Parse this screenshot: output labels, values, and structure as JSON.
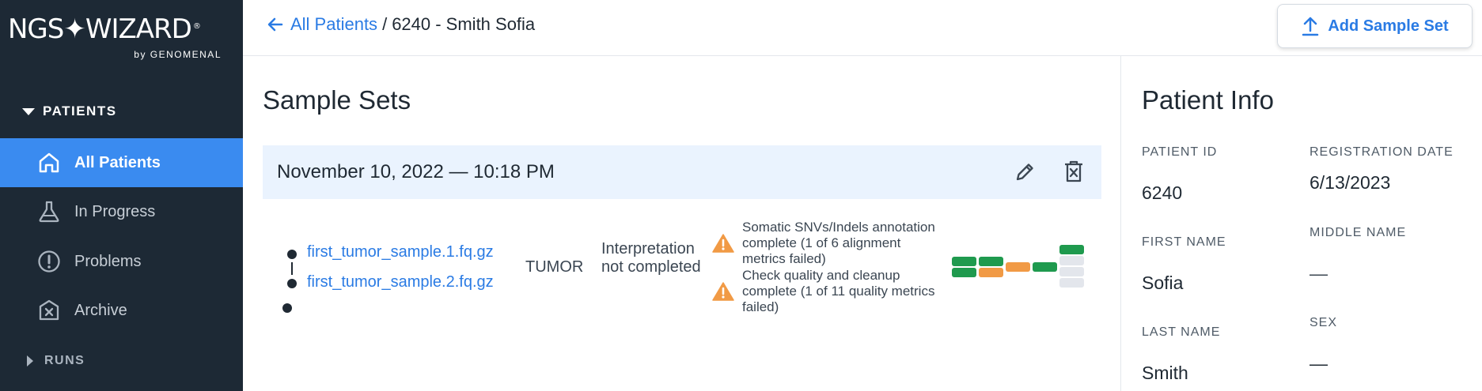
{
  "brand": {
    "name": "NGS✦WIZARD",
    "registered": "®",
    "by": "by GENOMENAL"
  },
  "sidebar": {
    "section_patients": "PATIENTS",
    "items": [
      {
        "label": "All Patients",
        "icon": "home-icon",
        "active": true
      },
      {
        "label": "In Progress",
        "icon": "flask-icon",
        "active": false
      },
      {
        "label": "Problems",
        "icon": "alert-circle-icon",
        "active": false
      },
      {
        "label": "Archive",
        "icon": "archive-box-icon",
        "active": false
      }
    ],
    "section_runs": "RUNS"
  },
  "header": {
    "back_link": "All Patients",
    "separator": "/",
    "current": "6240 - Smith Sofia",
    "add_button": "Add Sample Set"
  },
  "main": {
    "title": "Sample Sets",
    "sample_set": {
      "date": "November 10, 2022 — 10:18 PM",
      "files": [
        "first_tumor_sample.1.fq.gz",
        "first_tumor_sample.2.fq.gz"
      ],
      "type": "TUMOR",
      "status": "Interpretation not completed",
      "warnings": [
        "Somatic SNVs/Indels annotation complete (1 of 6 alignment metrics failed)",
        "Check quality and cleanup complete (1 of 11 quality metrics failed)"
      ],
      "metric_colors": {
        "pass": "#1f9a4e",
        "fail": "#f19a45",
        "pending": "#e3e6ec"
      }
    }
  },
  "patient_info": {
    "title": "Patient Info",
    "patient_id_label": "PATIENT ID",
    "patient_id": "6240",
    "registration_date_label": "REGISTRATION DATE",
    "registration_date": "6/13/2023",
    "first_name_label": "FIRST NAME",
    "first_name": "Sofia",
    "middle_name_label": "MIDDLE NAME",
    "middle_name": "—",
    "last_name_label": "LAST NAME",
    "last_name": "Smith",
    "sex_label": "SEX",
    "sex": "—"
  }
}
